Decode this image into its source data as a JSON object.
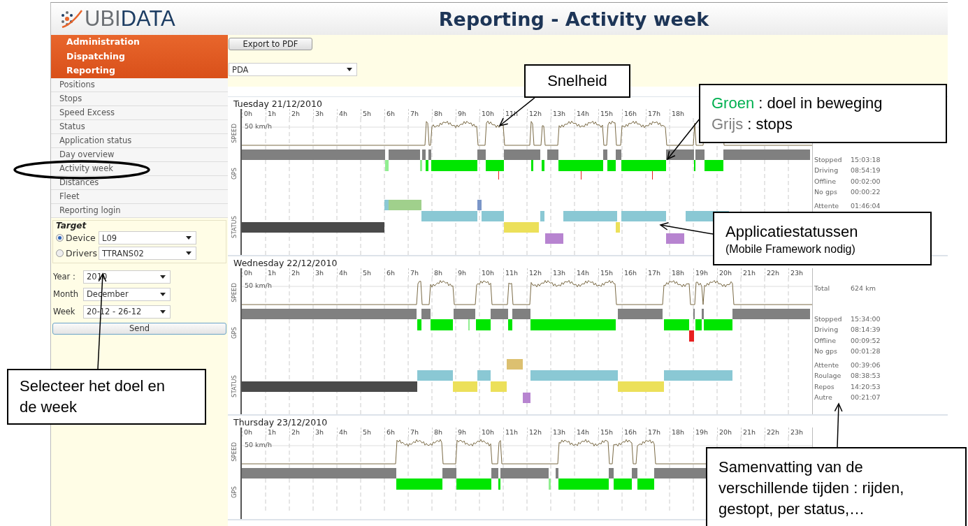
{
  "header": {
    "logo": [
      "UBI",
      "DATA"
    ],
    "title": "Reporting - Activity week"
  },
  "menu": [
    "Administration",
    "Dispatching",
    "Reporting"
  ],
  "submenu": [
    "Positions",
    "Stops",
    "Speed Excess",
    "Status",
    "Application status",
    "Day overview",
    "Activity week",
    "Distances",
    "Fleet",
    "Reporting login"
  ],
  "target": {
    "title": "Target",
    "options": [
      {
        "label": "Device",
        "selected": true,
        "value": "L09"
      },
      {
        "label": "Drivers",
        "selected": false,
        "value": "TTRANS02"
      }
    ]
  },
  "period": [
    {
      "label": "Year :",
      "value": "2010"
    },
    {
      "label": "Month",
      "value": "December"
    },
    {
      "label": "Week",
      "value": "20-12 - 26-12"
    }
  ],
  "send_button": "Send",
  "toolbar": {
    "export_button": "Export to PDF",
    "source": "PDA"
  },
  "days": [
    {
      "title": "Tuesday 21/12/2010",
      "hours": [
        "0h",
        "1h",
        "2h",
        "3h",
        "4h",
        "5h",
        "6h",
        "7h",
        "8h",
        "9h",
        "10h",
        "11h",
        "12h",
        "13h",
        "14h",
        "15h",
        "16h",
        "17h",
        "18h"
      ],
      "speed_reference": "50 km/h",
      "row_labels": [
        "SPEED",
        "GPS",
        "STATUS"
      ],
      "summary": [
        {
          "kind": "gps",
          "items": [
            {
              "label": "Stopped",
              "value": "15:03:18"
            },
            {
              "label": "Driving",
              "value": "08:54:19"
            },
            {
              "label": "Offline",
              "value": "00:02:00"
            },
            {
              "label": "No gps",
              "value": "00:00:22"
            }
          ]
        },
        {
          "kind": "status",
          "items": [
            {
              "label": "Attente",
              "value": "01:46:04"
            }
          ]
        }
      ]
    },
    {
      "title": "Wednesday 22/12/2010",
      "hours": [
        "0h",
        "1h",
        "2h",
        "3h",
        "4h",
        "5h",
        "6h",
        "7h",
        "8h",
        "9h",
        "10h",
        "11h",
        "12h",
        "13h",
        "14h",
        "15h",
        "16h",
        "17h",
        "18h",
        "19h",
        "20h",
        "21h",
        "22h",
        "23h"
      ],
      "speed_reference": "50 km/h",
      "row_labels": [
        "SPEED",
        "GPS",
        "STATUS"
      ],
      "summary": [
        {
          "kind": "total",
          "items": [
            {
              "label": "Total",
              "value": "624 km"
            }
          ]
        },
        {
          "kind": "gps",
          "items": [
            {
              "label": "Stopped",
              "value": "15:34:00"
            },
            {
              "label": "Driving",
              "value": "08:14:39"
            },
            {
              "label": "Offline",
              "value": "00:09:52"
            },
            {
              "label": "No gps",
              "value": "00:01:28"
            }
          ]
        },
        {
          "kind": "status",
          "items": [
            {
              "label": "Attente",
              "value": "00:39:06"
            },
            {
              "label": "Roulage",
              "value": "08:38:53"
            },
            {
              "label": "Repos",
              "value": "14:20:53"
            },
            {
              "label": "Autre",
              "value": "00:21:07"
            }
          ]
        }
      ]
    },
    {
      "title": "Thursday 23/12/2010",
      "hours": [
        "0h",
        "1h",
        "2h",
        "3h",
        "4h",
        "5h",
        "6h",
        "7h",
        "8h",
        "9h",
        "10h",
        "11h",
        "12h",
        "13h",
        "14h",
        "15h",
        "16h",
        "17h",
        "18h",
        "19h",
        "20h",
        "21h",
        "22h",
        "23h"
      ],
      "speed_reference": "50 km/h",
      "row_labels": [
        "SPEED",
        "GPS"
      ]
    }
  ],
  "callouts": [
    {
      "lines": [
        {
          "kind": "main",
          "text": "Snelheid"
        }
      ]
    },
    {
      "lines": [
        {
          "kind": "legend",
          "term": "Groen",
          "color": "#00b050",
          "text": ": doel in beweging"
        },
        {
          "kind": "legend",
          "term": "Grijs",
          "color": "#808080",
          "text": ": stops"
        }
      ]
    },
    {
      "lines": [
        {
          "kind": "main",
          "text": "Applicatiestatussen"
        },
        {
          "kind": "note",
          "text": "(Mobile Framework nodig)"
        }
      ]
    },
    {
      "lines": [
        {
          "kind": "main",
          "text": "Selecteer het doel en de week"
        }
      ]
    },
    {
      "lines": [
        {
          "kind": "main",
          "text": "Samenvatting van de verschillende tijden : rijden, gestopt, per status,…"
        }
      ]
    }
  ]
}
